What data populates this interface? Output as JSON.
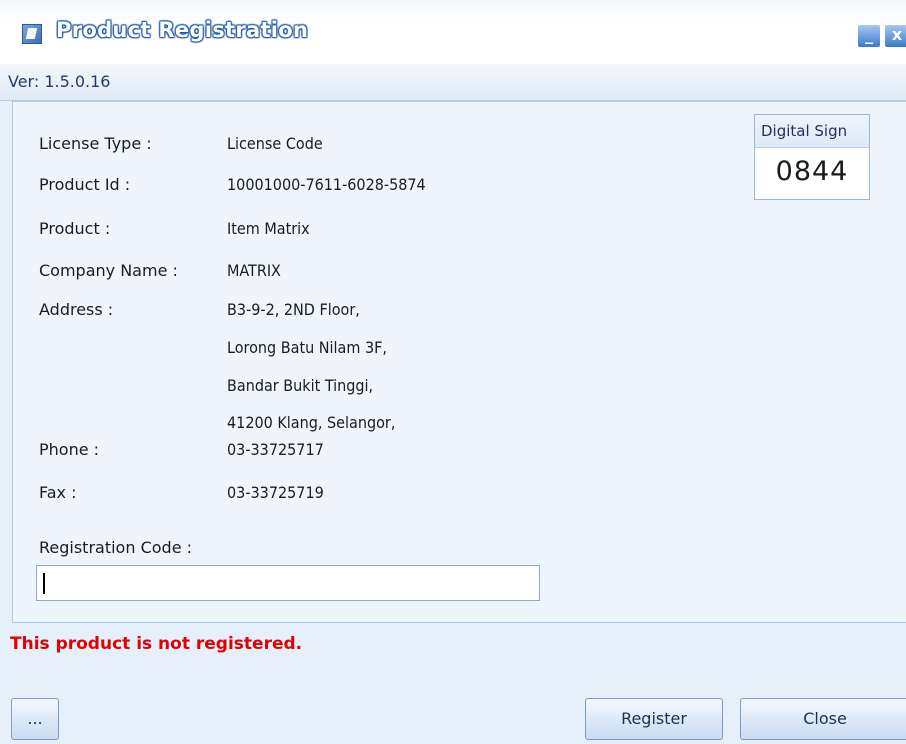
{
  "window": {
    "title": "Product Registration",
    "minimize_glyph": "_",
    "close_glyph": "x"
  },
  "version": "Ver: 1.5.0.16",
  "fields": {
    "license_type": {
      "label": "License Type :",
      "value": "License Code"
    },
    "product_id": {
      "label": "Product Id :",
      "value": "10001000-7611-6028-5874"
    },
    "product": {
      "label": "Product :",
      "value": "Item Matrix"
    },
    "company_name": {
      "label": "Company Name :",
      "value": "MATRIX"
    },
    "address": {
      "label": "Address :",
      "lines": [
        "B3-9-2, 2ND Floor,",
        "Lorong Batu Nilam 3F,",
        "Bandar Bukit Tinggi,",
        "41200 Klang, Selangor,"
      ]
    },
    "phone": {
      "label": "Phone :",
      "value": "03-33725717"
    },
    "fax": {
      "label": "Fax :",
      "value": "03-33725719"
    }
  },
  "digital_sign": {
    "label": "Digital Sign",
    "value": "0844"
  },
  "registration": {
    "label": "Registration Code :",
    "value": ""
  },
  "status_message": "This product is not registered.",
  "buttons": {
    "more": "...",
    "register": "Register",
    "close": "Close"
  },
  "colors": {
    "warning": "#e30000",
    "title_text": "#ffffff",
    "title_outline": "#1f5aa8"
  }
}
